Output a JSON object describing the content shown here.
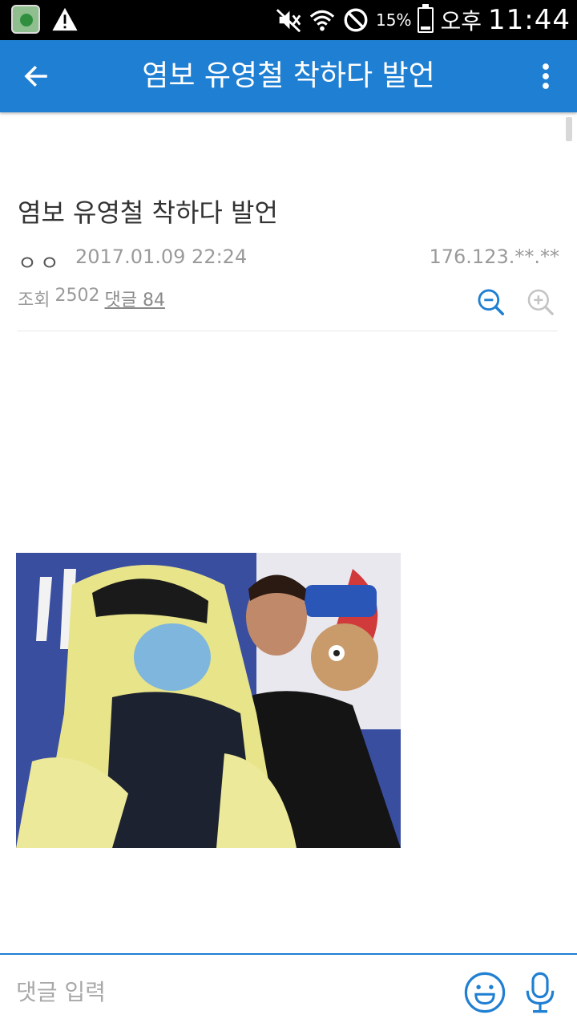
{
  "status_bar": {
    "battery_percent": "15%",
    "battery_level": 0.15,
    "ampm": "오후",
    "time": "11:44"
  },
  "app_bar": {
    "title": "염보 유영철 착하다 발언"
  },
  "post": {
    "title": "염보 유영철 착하다 발언",
    "author": "ㅇㅇ",
    "date": "2017.01.09 22:24",
    "ip": "176.123.**.**",
    "views_label": "조회",
    "views": "2502",
    "comments_label": "댓글",
    "comments": "84"
  },
  "comment_bar": {
    "placeholder": "댓글 입력"
  },
  "colors": {
    "accent": "#1f7fd2",
    "muted_text": "#9a9a9a"
  },
  "icons": {
    "back": "arrow-left-icon",
    "more": "more-vert-icon",
    "zoom_out": "zoom-out-icon",
    "zoom_in": "zoom-in-icon",
    "emoji": "emoji-icon",
    "mic": "microphone-icon"
  }
}
